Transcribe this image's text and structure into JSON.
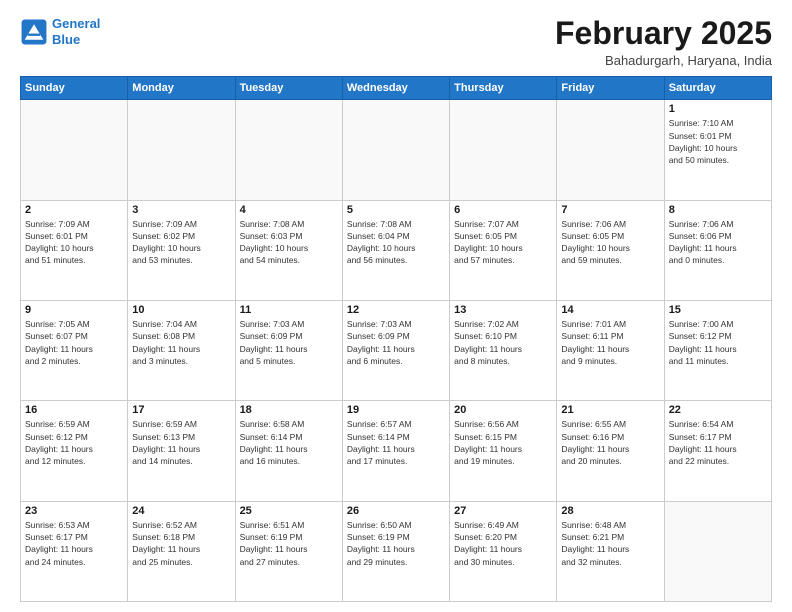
{
  "header": {
    "logo_line1": "General",
    "logo_line2": "Blue",
    "month": "February 2025",
    "location": "Bahadurgarh, Haryana, India"
  },
  "weekdays": [
    "Sunday",
    "Monday",
    "Tuesday",
    "Wednesday",
    "Thursday",
    "Friday",
    "Saturday"
  ],
  "weeks": [
    [
      {
        "day": "",
        "info": ""
      },
      {
        "day": "",
        "info": ""
      },
      {
        "day": "",
        "info": ""
      },
      {
        "day": "",
        "info": ""
      },
      {
        "day": "",
        "info": ""
      },
      {
        "day": "",
        "info": ""
      },
      {
        "day": "1",
        "info": "Sunrise: 7:10 AM\nSunset: 6:01 PM\nDaylight: 10 hours\nand 50 minutes."
      }
    ],
    [
      {
        "day": "2",
        "info": "Sunrise: 7:09 AM\nSunset: 6:01 PM\nDaylight: 10 hours\nand 51 minutes."
      },
      {
        "day": "3",
        "info": "Sunrise: 7:09 AM\nSunset: 6:02 PM\nDaylight: 10 hours\nand 53 minutes."
      },
      {
        "day": "4",
        "info": "Sunrise: 7:08 AM\nSunset: 6:03 PM\nDaylight: 10 hours\nand 54 minutes."
      },
      {
        "day": "5",
        "info": "Sunrise: 7:08 AM\nSunset: 6:04 PM\nDaylight: 10 hours\nand 56 minutes."
      },
      {
        "day": "6",
        "info": "Sunrise: 7:07 AM\nSunset: 6:05 PM\nDaylight: 10 hours\nand 57 minutes."
      },
      {
        "day": "7",
        "info": "Sunrise: 7:06 AM\nSunset: 6:05 PM\nDaylight: 10 hours\nand 59 minutes."
      },
      {
        "day": "8",
        "info": "Sunrise: 7:06 AM\nSunset: 6:06 PM\nDaylight: 11 hours\nand 0 minutes."
      }
    ],
    [
      {
        "day": "9",
        "info": "Sunrise: 7:05 AM\nSunset: 6:07 PM\nDaylight: 11 hours\nand 2 minutes."
      },
      {
        "day": "10",
        "info": "Sunrise: 7:04 AM\nSunset: 6:08 PM\nDaylight: 11 hours\nand 3 minutes."
      },
      {
        "day": "11",
        "info": "Sunrise: 7:03 AM\nSunset: 6:09 PM\nDaylight: 11 hours\nand 5 minutes."
      },
      {
        "day": "12",
        "info": "Sunrise: 7:03 AM\nSunset: 6:09 PM\nDaylight: 11 hours\nand 6 minutes."
      },
      {
        "day": "13",
        "info": "Sunrise: 7:02 AM\nSunset: 6:10 PM\nDaylight: 11 hours\nand 8 minutes."
      },
      {
        "day": "14",
        "info": "Sunrise: 7:01 AM\nSunset: 6:11 PM\nDaylight: 11 hours\nand 9 minutes."
      },
      {
        "day": "15",
        "info": "Sunrise: 7:00 AM\nSunset: 6:12 PM\nDaylight: 11 hours\nand 11 minutes."
      }
    ],
    [
      {
        "day": "16",
        "info": "Sunrise: 6:59 AM\nSunset: 6:12 PM\nDaylight: 11 hours\nand 12 minutes."
      },
      {
        "day": "17",
        "info": "Sunrise: 6:59 AM\nSunset: 6:13 PM\nDaylight: 11 hours\nand 14 minutes."
      },
      {
        "day": "18",
        "info": "Sunrise: 6:58 AM\nSunset: 6:14 PM\nDaylight: 11 hours\nand 16 minutes."
      },
      {
        "day": "19",
        "info": "Sunrise: 6:57 AM\nSunset: 6:14 PM\nDaylight: 11 hours\nand 17 minutes."
      },
      {
        "day": "20",
        "info": "Sunrise: 6:56 AM\nSunset: 6:15 PM\nDaylight: 11 hours\nand 19 minutes."
      },
      {
        "day": "21",
        "info": "Sunrise: 6:55 AM\nSunset: 6:16 PM\nDaylight: 11 hours\nand 20 minutes."
      },
      {
        "day": "22",
        "info": "Sunrise: 6:54 AM\nSunset: 6:17 PM\nDaylight: 11 hours\nand 22 minutes."
      }
    ],
    [
      {
        "day": "23",
        "info": "Sunrise: 6:53 AM\nSunset: 6:17 PM\nDaylight: 11 hours\nand 24 minutes."
      },
      {
        "day": "24",
        "info": "Sunrise: 6:52 AM\nSunset: 6:18 PM\nDaylight: 11 hours\nand 25 minutes."
      },
      {
        "day": "25",
        "info": "Sunrise: 6:51 AM\nSunset: 6:19 PM\nDaylight: 11 hours\nand 27 minutes."
      },
      {
        "day": "26",
        "info": "Sunrise: 6:50 AM\nSunset: 6:19 PM\nDaylight: 11 hours\nand 29 minutes."
      },
      {
        "day": "27",
        "info": "Sunrise: 6:49 AM\nSunset: 6:20 PM\nDaylight: 11 hours\nand 30 minutes."
      },
      {
        "day": "28",
        "info": "Sunrise: 6:48 AM\nSunset: 6:21 PM\nDaylight: 11 hours\nand 32 minutes."
      },
      {
        "day": "",
        "info": ""
      }
    ]
  ]
}
